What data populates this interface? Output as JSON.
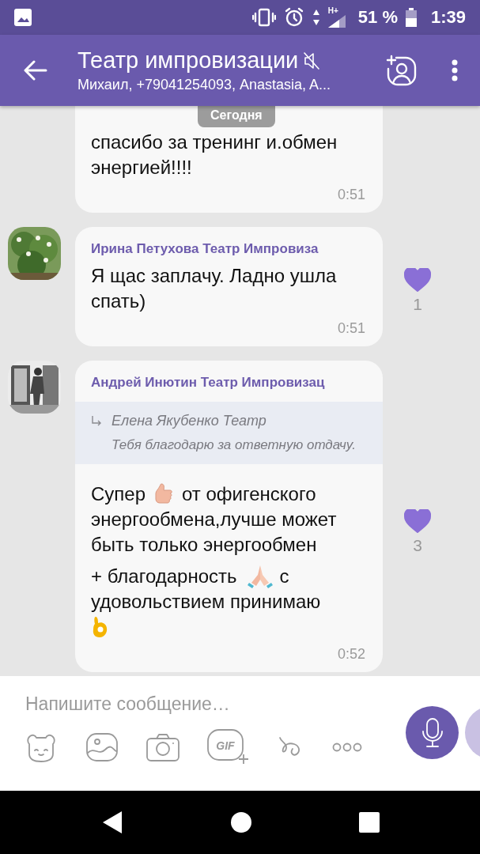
{
  "status_bar": {
    "network": "H+",
    "battery": "51 %",
    "time": "1:39"
  },
  "header": {
    "title": "Театр импровизации",
    "muted": true,
    "subtitle": "Михаил, +79041254093, Anastasia, A..."
  },
  "date_badge": "Сегодня",
  "messages": [
    {
      "paragraphs": [
        [
          [
            {
              "kind": "text",
              "text": "спасибо за тренинг и.обмен"
            }
          ],
          [
            {
              "kind": "text",
              "text": "энергией!!!!"
            }
          ]
        ]
      ],
      "time": "0:51"
    },
    {
      "sender": "Ирина Петухова Театр Импровиза",
      "avatar": {
        "kind": "picture"
      },
      "paragraphs": [
        [
          [
            {
              "kind": "text",
              "text": "Я щас заплачу. Ладно ушла"
            }
          ],
          [
            {
              "kind": "text",
              "text": "спать)"
            }
          ]
        ]
      ],
      "time": "0:51",
      "likes": {
        "liked": true,
        "count": "1"
      }
    },
    {
      "sender": "Андрей Инютин Театр Импровизац",
      "avatar": {
        "kind": "picture"
      },
      "reply": {
        "name": "Елена Якубенко Театр",
        "text": "Тебя благодарю за ответную отдачу."
      },
      "paragraphs": [
        [
          [
            {
              "kind": "text",
              "text": "Супер"
            },
            {
              "kind": "thumbsup"
            },
            {
              "kind": "text",
              "text": "от офигенского"
            }
          ],
          [
            {
              "kind": "text",
              "text": "энергообмена,лучше может"
            }
          ],
          [
            {
              "kind": "text",
              "text": "быть только энергообмен"
            }
          ]
        ],
        [
          [
            {
              "kind": "text",
              "text": "+ благодарность"
            },
            {
              "kind": "pray"
            },
            {
              "kind": "text",
              "text": "с"
            }
          ],
          [
            {
              "kind": "text",
              "text": "удовольствием принимаю"
            }
          ],
          [
            {
              "kind": "okhand"
            }
          ]
        ]
      ],
      "time": "0:52",
      "likes": {
        "liked": true,
        "count": "3"
      }
    }
  ],
  "composer": {
    "placeholder": "Напишите сообщение…",
    "gif_label": "GIF"
  }
}
